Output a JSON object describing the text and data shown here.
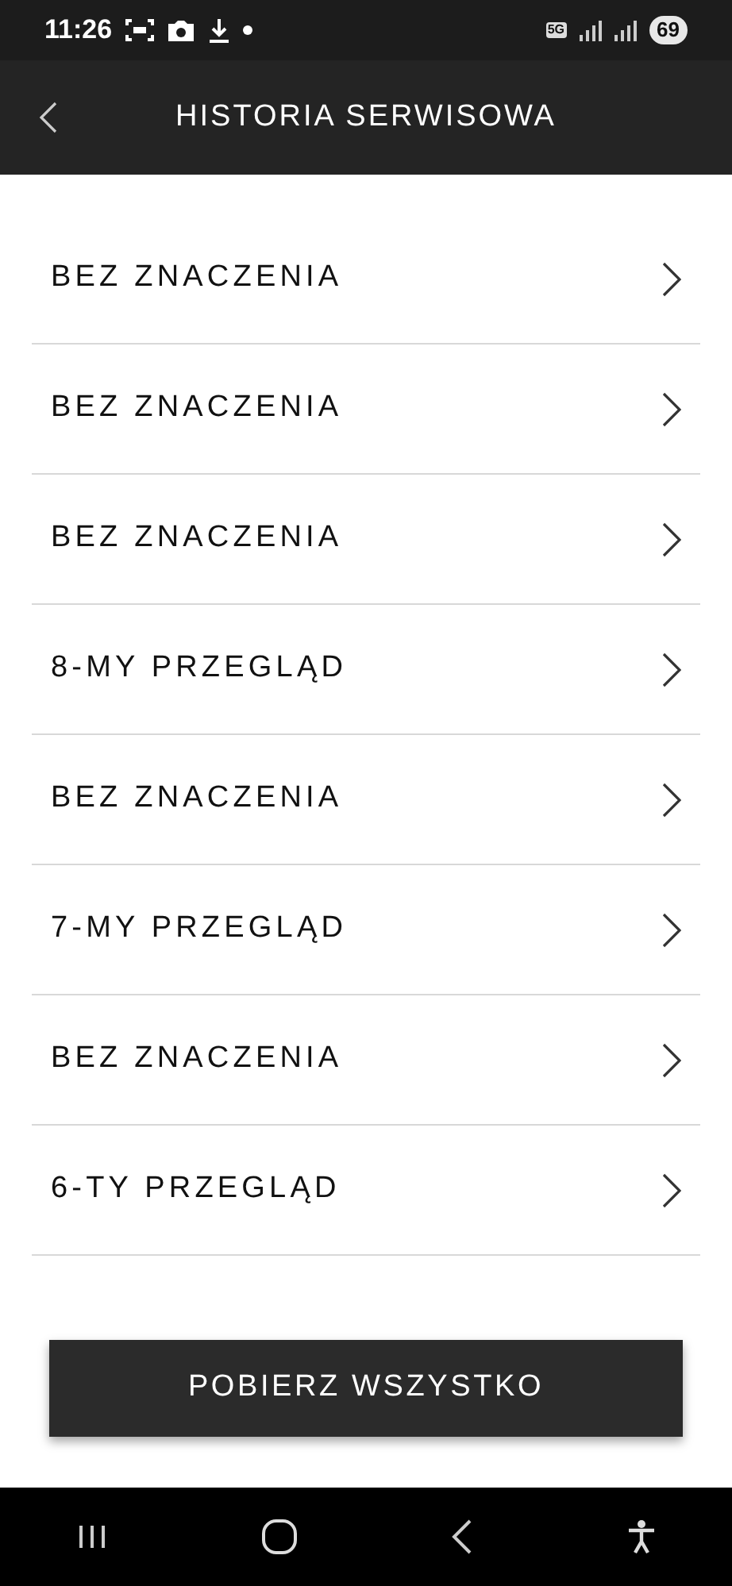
{
  "status_bar": {
    "time": "11:26",
    "network": "5G",
    "battery": "69"
  },
  "header": {
    "title": "HISTORIA SERWISOWA"
  },
  "items": [
    {
      "label": "BEZ ZNACZENIA"
    },
    {
      "label": "BEZ ZNACZENIA"
    },
    {
      "label": "BEZ ZNACZENIA"
    },
    {
      "label": "8-MY PRZEGLĄD"
    },
    {
      "label": "BEZ ZNACZENIA"
    },
    {
      "label": "7-MY PRZEGLĄD"
    },
    {
      "label": "BEZ ZNACZENIA"
    },
    {
      "label": "6-TY PRZEGLĄD"
    }
  ],
  "download_button": {
    "label": "POBIERZ WSZYSTKO"
  }
}
